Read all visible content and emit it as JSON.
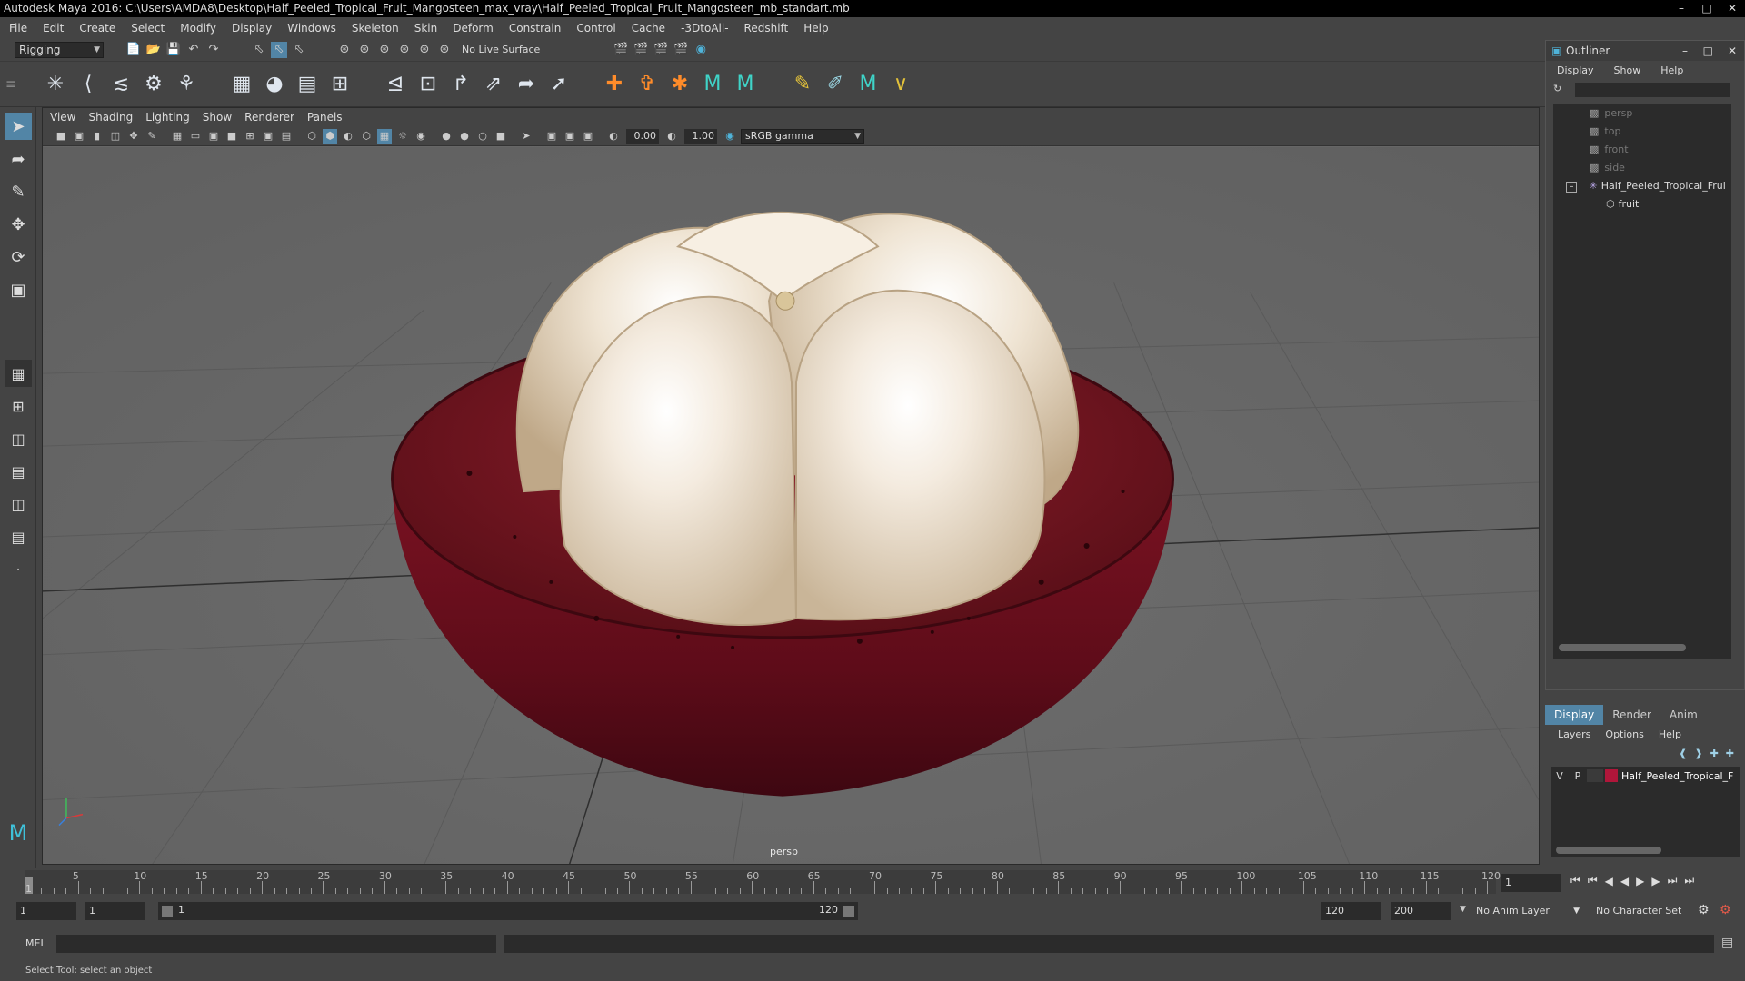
{
  "window": {
    "title": "Autodesk Maya 2016: C:\\Users\\AMDA8\\Desktop\\Half_Peeled_Tropical_Fruit_Mangosteen_max_vray\\Half_Peeled_Tropical_Fruit_Mangosteen_mb_standart.mb"
  },
  "menubar": [
    "File",
    "Edit",
    "Create",
    "Select",
    "Modify",
    "Display",
    "Windows",
    "Skeleton",
    "Skin",
    "Deform",
    "Constrain",
    "Control",
    "Cache",
    "-3DtoAll-",
    "Redshift",
    "Help"
  ],
  "statusline": {
    "menuset": "Rigging",
    "live_surface": "No Live Surface"
  },
  "viewport": {
    "menu": [
      "View",
      "Shading",
      "Lighting",
      "Show",
      "Renderer",
      "Panels"
    ],
    "exposure": "0.00",
    "gamma": "1.00",
    "color_space": "sRGB gamma",
    "camera_label": "persp",
    "colors": {
      "background": "#6b6b6b",
      "rind": "#6e0f1e",
      "flesh": "#efe4d3"
    }
  },
  "outliner": {
    "title": "Outliner",
    "menu": [
      "Display",
      "Show",
      "Help"
    ],
    "items": [
      {
        "label": "persp",
        "icon": "camera-icon"
      },
      {
        "label": "top",
        "icon": "camera-icon"
      },
      {
        "label": "front",
        "icon": "camera-icon"
      },
      {
        "label": "side",
        "icon": "camera-icon"
      },
      {
        "label": "Half_Peeled_Tropical_Frui",
        "icon": "group-icon"
      },
      {
        "label": "fruit",
        "icon": "mesh-icon"
      }
    ]
  },
  "layer_editor": {
    "tabs": [
      "Display",
      "Render",
      "Anim"
    ],
    "menu": [
      "Layers",
      "Options",
      "Help"
    ],
    "layer": {
      "v": "V",
      "p": "P",
      "name": "Half_Peeled_Tropical_F",
      "color": "#b0163a"
    }
  },
  "timeline": {
    "ticks": [
      "5",
      "10",
      "15",
      "20",
      "25",
      "30",
      "35",
      "40",
      "45",
      "50",
      "55",
      "60",
      "65",
      "70",
      "75",
      "80",
      "85",
      "90",
      "95",
      "100",
      "105",
      "110",
      "115",
      "120"
    ],
    "start_label": "1",
    "current_frame": "1"
  },
  "range": {
    "start": "1",
    "playback_start": "1",
    "slider_start": "1",
    "slider_end": "120",
    "playback_end": "120",
    "end": "200",
    "anim_layer": "No Anim Layer",
    "character_set": "No Character Set"
  },
  "command": {
    "label": "MEL"
  },
  "helpline": {
    "text": "Select Tool: select an object"
  }
}
